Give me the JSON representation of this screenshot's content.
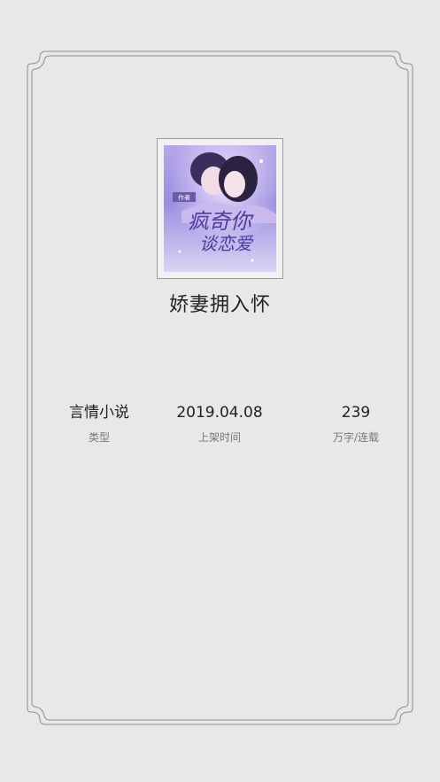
{
  "book": {
    "title": "娇妻拥入怀",
    "cover_icon": "book-cover-image"
  },
  "stats": [
    {
      "value": "言情小说",
      "label": "类型"
    },
    {
      "value": "2019.04.08",
      "label": "上架时间"
    },
    {
      "value": "239",
      "label": "万字/连载"
    }
  ],
  "colors": {
    "background": "#e8e8e8",
    "frame": "#8a8a8a",
    "text": "#222222",
    "muted": "#777777",
    "cover_purple": "#8e7fd6"
  }
}
